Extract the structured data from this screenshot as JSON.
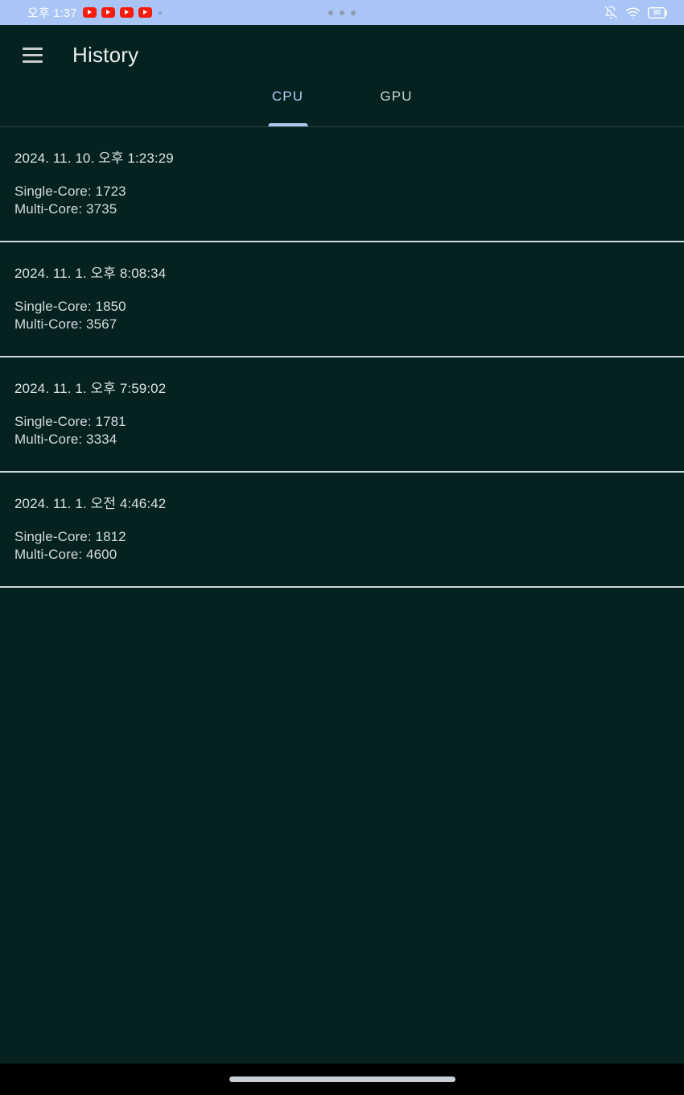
{
  "status_bar": {
    "clock": "오후 1:37",
    "notification_icons": [
      "youtube-icon",
      "youtube-icon",
      "youtube-icon",
      "youtube-icon"
    ],
    "overflow_indicator": "more-notifications-dot",
    "center_dots": "camera-punch-hole-dots",
    "right_icons": [
      "notifications-muted-icon",
      "wifi-icon",
      "battery-icon"
    ],
    "battery_level": "80",
    "background_color": "#a8c5f5"
  },
  "app_bar": {
    "menu_icon": "hamburger-icon",
    "title": "History"
  },
  "tabs": {
    "active_index": 0,
    "items": [
      {
        "label": "CPU",
        "active": true
      },
      {
        "label": "GPU",
        "active": false
      }
    ],
    "active_color": "#b2cbf2",
    "inactive_color": "#c9d2d2",
    "indicator_color": "#aac8f0"
  },
  "history": {
    "items": [
      {
        "date": "2024. 11. 10. 오후 1:23:29",
        "single_core": "Single-Core: 1723",
        "multi_core": "Multi-Core: 3735"
      },
      {
        "date": "2024. 11. 1. 오후 8:08:34",
        "single_core": "Single-Core: 1850",
        "multi_core": "Multi-Core: 3567"
      },
      {
        "date": "2024. 11. 1. 오후 7:59:02",
        "single_core": "Single-Core: 1781",
        "multi_core": "Multi-Core: 3334"
      },
      {
        "date": "2024. 11. 1. 오전 4:46:42",
        "single_core": "Single-Core: 1812",
        "multi_core": "Multi-Core: 4600"
      }
    ]
  },
  "nav_bar": {
    "gesture_pill": "home-gesture-pill"
  },
  "theme": {
    "background": "#052221",
    "text_primary": "#e9eeee",
    "divider": "#cfd8d8"
  }
}
